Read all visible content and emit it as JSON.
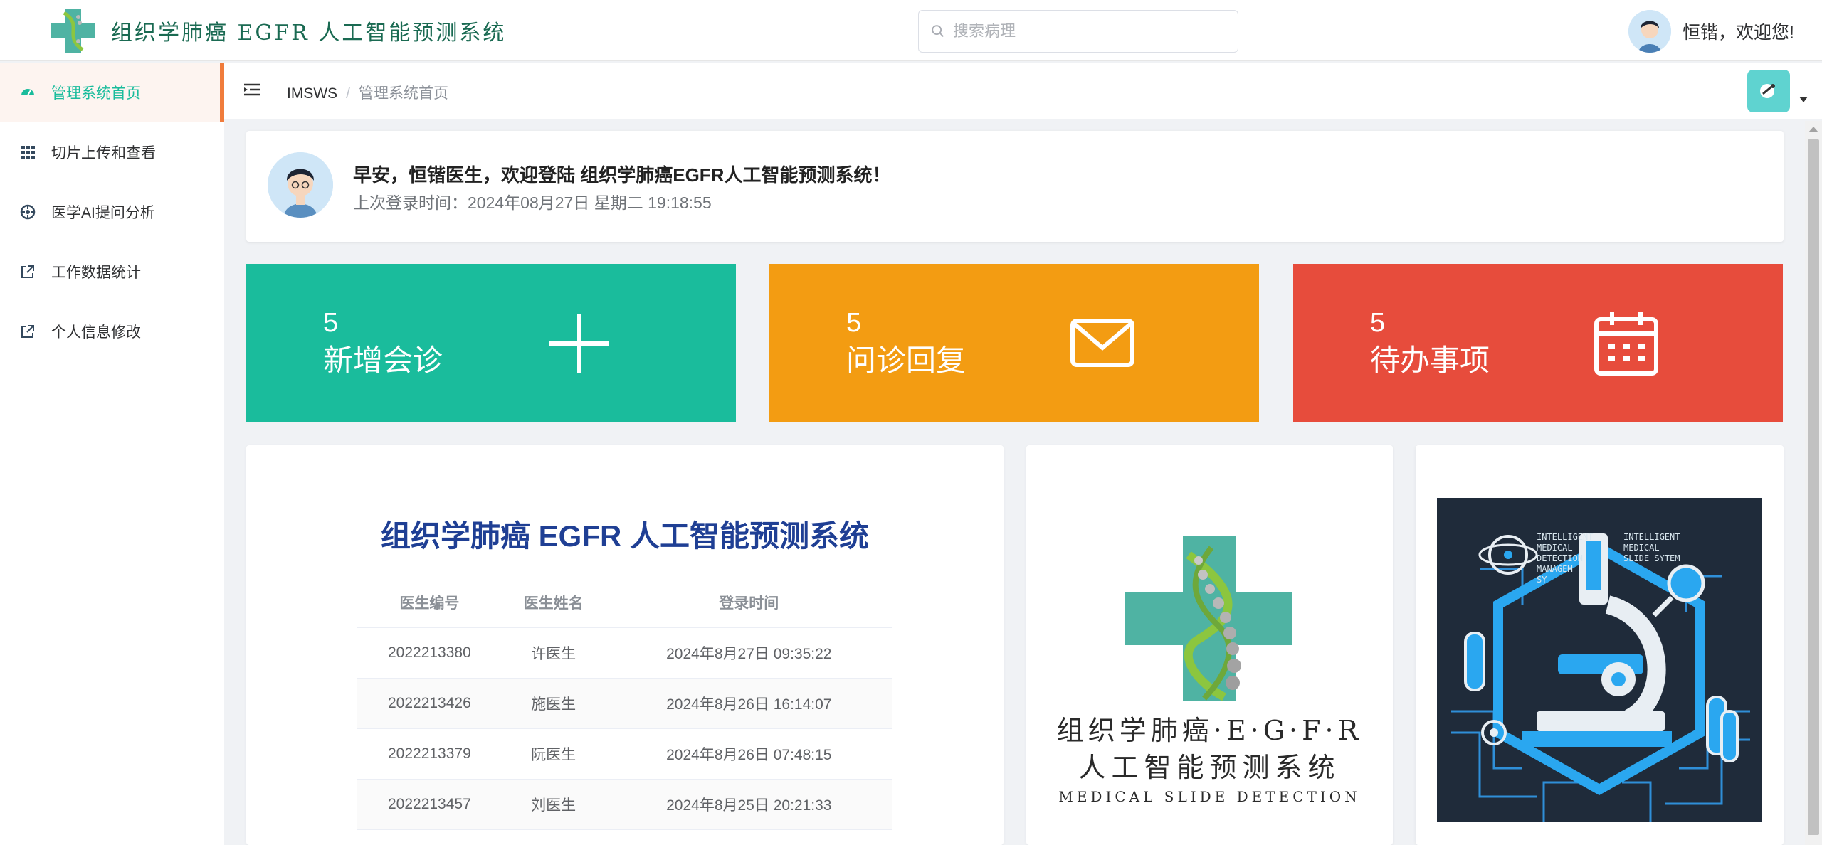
{
  "header": {
    "app_title": "组织学肺癌 EGFR 人工智能预测系统",
    "search_placeholder": "搜索病理",
    "greeting": "恒锴，欢迎您!"
  },
  "sidebar": {
    "items": [
      {
        "label": "管理系统首页",
        "icon": "dashboard-icon",
        "active": true
      },
      {
        "label": "切片上传和查看",
        "icon": "grid-icon",
        "active": false
      },
      {
        "label": "医学AI提问分析",
        "icon": "aperture-icon",
        "active": false
      },
      {
        "label": "工作数据统计",
        "icon": "external-link-icon",
        "active": false
      },
      {
        "label": "个人信息修改",
        "icon": "external-link-icon",
        "active": false
      }
    ]
  },
  "breadcrumb": {
    "home": "IMSWS",
    "separator": "/",
    "current": "管理系统首页"
  },
  "welcome": {
    "title": "早安，恒锴医生，欢迎登陆 组织学肺癌EGFR人工智能预测系统！",
    "last_login": "上次登录时间：2024年08月27日 星期二 19:18:55"
  },
  "stats": [
    {
      "count": "5",
      "label": "新增会诊",
      "icon": "plus-icon",
      "color": "#1abc9c"
    },
    {
      "count": "5",
      "label": "问诊回复",
      "icon": "mail-icon",
      "color": "#f39c12"
    },
    {
      "count": "5",
      "label": "待办事项",
      "icon": "calendar-icon",
      "color": "#e74c3c"
    }
  ],
  "login_panel": {
    "title": "组织学肺癌 EGFR 人工智能预测系统",
    "columns": [
      "医生编号",
      "医生姓名",
      "登录时间"
    ],
    "rows": [
      [
        "2022213380",
        "许医生",
        "2024年8月27日 09:35:22"
      ],
      [
        "2022213426",
        "施医生",
        "2024年8月26日 16:14:07"
      ],
      [
        "2022213379",
        "阮医生",
        "2024年8月26日 07:48:15"
      ],
      [
        "2022213457",
        "刘医生",
        "2024年8月25日 20:21:33"
      ]
    ]
  },
  "logo_panel": {
    "line1": "组织学肺癌·E·G·F·R",
    "line2": "人工智能预测系统",
    "line3": "MEDICAL SLIDE DETECTION"
  },
  "poster_panel": {
    "text_left": "INTELLIGENT MEDICAL DETECTION MANAGEM SY",
    "text_right": "INTELLIGENT MEDICAL SLIDE SYTEM"
  },
  "colors": {
    "accent": "#1abc9c",
    "active_indicator": "#f07c3c",
    "title_blue": "#1f3f94"
  }
}
